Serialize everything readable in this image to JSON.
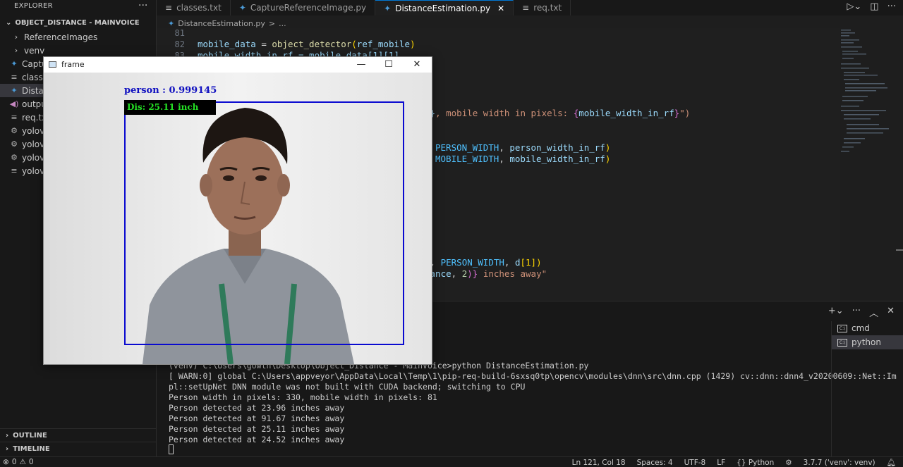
{
  "sidebar": {
    "title": "EXPLORER",
    "more": "···",
    "root_folder": "OBJECT_DISTANCE - MAINVOICE",
    "items": [
      {
        "label": "ReferenceImages",
        "icon": "chevron-right-icon"
      },
      {
        "label": "venv",
        "icon": "chevron-right-icon"
      },
      {
        "label": "Captu",
        "icon": "python-icon"
      },
      {
        "label": "classe",
        "icon": "text-file-icon"
      },
      {
        "label": "Distan",
        "icon": "python-icon"
      },
      {
        "label": "outpu",
        "icon": "audio-file-icon"
      },
      {
        "label": "req.tx",
        "icon": "text-file-icon"
      },
      {
        "label": "yolov3",
        "icon": "gear-icon"
      },
      {
        "label": "yolov3",
        "icon": "gear-icon"
      },
      {
        "label": "yolov4",
        "icon": "gear-icon"
      },
      {
        "label": "yolov",
        "icon": "text-file-icon"
      }
    ],
    "outline": "OUTLINE",
    "timeline": "TIMELINE"
  },
  "tabs": [
    {
      "label": "classes.txt",
      "icon": "text-file-icon"
    },
    {
      "label": "CaptureReferenceImage.py",
      "icon": "python-icon"
    },
    {
      "label": "DistanceEstimation.py",
      "icon": "python-icon",
      "active": true
    },
    {
      "label": "req.txt",
      "icon": "text-file-icon"
    }
  ],
  "breadcrumb": {
    "file": "DistanceEstimation.py",
    "sep": ">",
    "rest": "..."
  },
  "editor": {
    "lines": {
      "l81": "81",
      "l82": "82",
      "l83": "83"
    },
    "code82": {
      "a": "mobile_data",
      "b": " = ",
      "c": "object_detector",
      "d": "(",
      "e": "ref_mobile",
      "f": ")"
    },
    "code83": "mobile_width_in_rf = mobile_data[1][1]",
    "frag1": {
      "a": "f}",
      "b": ", mobile width in pixels: ",
      "c": "{",
      "d": "mobile_width_in_rf",
      "e": "}",
      "f": "\")"
    },
    "frag2": {
      "a": "PERSON_WIDTH",
      "b": ", ",
      "c": "person_width_in_rf",
      "d": ")"
    },
    "frag3": {
      "a": "MOBILE_WIDTH",
      "b": ", ",
      "c": "mobile_width_in_rf",
      "d": ")"
    },
    "frag4": {
      "a": "n",
      "b": ", ",
      "c": "PERSON_WIDTH",
      "d": ", ",
      "e": "d",
      "f": "[1])"
    },
    "frag5": {
      "a": "tance",
      "b": ", ",
      "c": "2",
      "d": ")}",
      "e": " inches away\""
    }
  },
  "terminal": {
    "lines": [
      "(venv) C:\\Users\\gowth\\Desktop\\Object_Distance - MainVoice>python DistanceEstimation.py",
      "[ WARN:0] global C:\\Users\\appveyor\\AppData\\Local\\Temp\\1\\pip-req-build-6sxsq0tp\\opencv\\modules\\dnn\\src\\dnn.cpp (1429) cv::dnn::dnn4_v20200609::Net::Im",
      "pl::setUpNet DNN module was not built with CUDA backend; switching to CPU",
      "Person width in pixels: 330, mobile width in pixels: 81",
      "Person detected at 23.96 inches away",
      "Person detected at 91.67 inches away",
      "Person detected at 25.11 inches away",
      "Person detected at 24.52 inches away"
    ],
    "list": [
      {
        "label": "cmd"
      },
      {
        "label": "python",
        "active": true
      }
    ]
  },
  "frame_window": {
    "title": "frame",
    "detection_label": "person : 0.999145",
    "distance_label": "Dis: 25.11 inch"
  },
  "statusbar": {
    "errors": "0",
    "warnings": "0",
    "position": "Ln 121, Col 18",
    "spaces": "Spaces: 4",
    "encoding": "UTF-8",
    "eol": "LF",
    "language": "Python",
    "interpreter": "3.7.7 ('venv': venv)"
  },
  "colors": {
    "accent": "#0078d4",
    "box": "#0a0ad0",
    "distance_text": "#24e024"
  }
}
